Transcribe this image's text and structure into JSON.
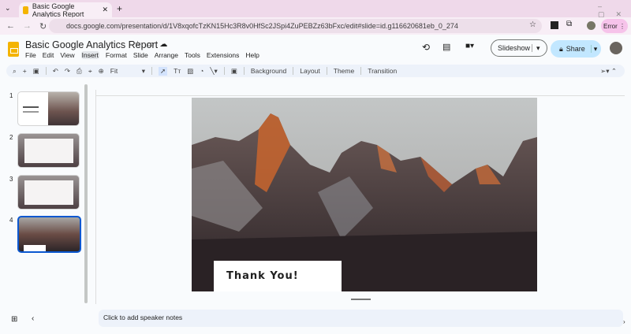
{
  "browser": {
    "tab_title": "Basic Google Analytics Report",
    "url": "docs.google.com/presentation/d/1V8xqofcTzKN15Hc3R8v0HfSc2JSpi4ZuPEBZz63bFxc/edit#slide=id.g116620681eb_0_274",
    "error_label": "Error"
  },
  "app": {
    "title": "Basic Google Analytics Report",
    "menu": [
      "File",
      "Edit",
      "View",
      "Insert",
      "Format",
      "Slide",
      "Arrange",
      "Tools",
      "Extensions",
      "Help"
    ],
    "slideshow_label": "Slideshow",
    "share_label": "Share"
  },
  "toolbar": {
    "zoom": "Fit",
    "background": "Background",
    "layout": "Layout",
    "theme": "Theme",
    "transition": "Transition"
  },
  "filmstrip": {
    "slides": [
      "1",
      "2",
      "3",
      "4"
    ],
    "selected": "4"
  },
  "slide": {
    "text": "Thank You!"
  },
  "notes": {
    "placeholder": "Click to add speaker notes"
  },
  "colors": {
    "accent": "#0b57d0",
    "share_bg": "#c2e7ff"
  }
}
